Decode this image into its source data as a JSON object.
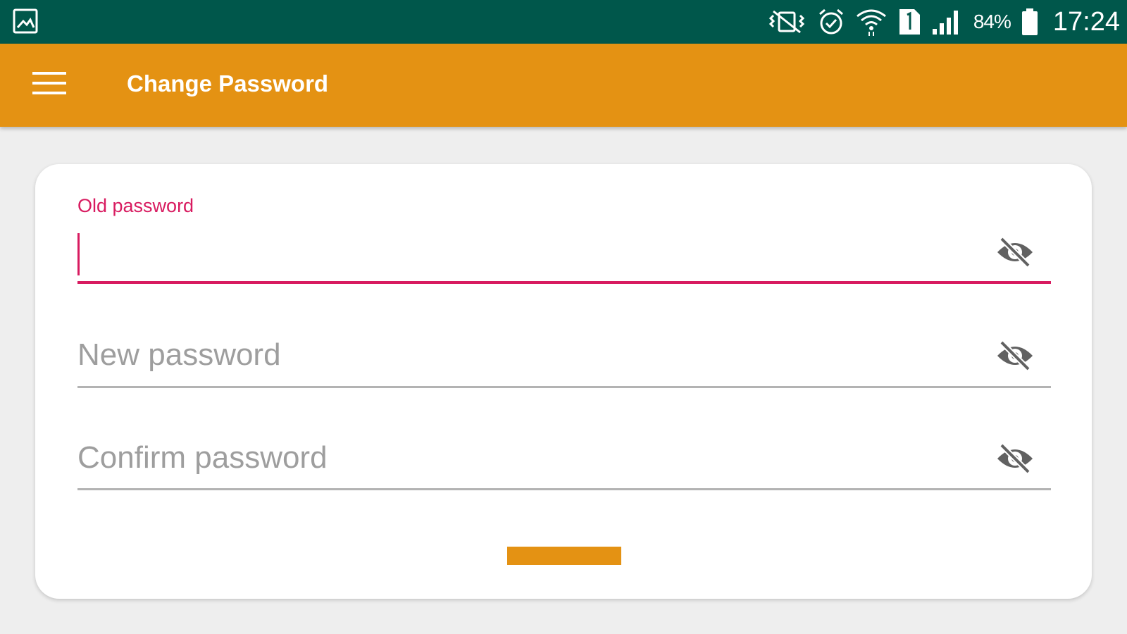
{
  "status_bar": {
    "icons": [
      "gallery-icon",
      "vibrate-icon",
      "alarm-icon",
      "wifi-icon",
      "sim-card-icon",
      "signal-icon",
      "battery-icon"
    ],
    "battery_percent": "84%",
    "time": "17:24"
  },
  "app_bar": {
    "menu_icon": "hamburger-menu-icon",
    "title": "Change Password"
  },
  "form": {
    "old_password": {
      "label": "Old password",
      "value": "",
      "focused": true,
      "toggle_icon": "visibility-off-icon"
    },
    "new_password": {
      "placeholder": "New password",
      "value": "",
      "toggle_icon": "visibility-off-icon"
    },
    "confirm_password": {
      "placeholder": "Confirm password",
      "value": "",
      "toggle_icon": "visibility-off-icon"
    },
    "submit_button": {
      "label": ""
    }
  },
  "colors": {
    "status_bar": "#00574b",
    "app_bar": "#e49213",
    "accent": "#d81b60",
    "background": "#eeeeee",
    "card": "#ffffff",
    "placeholder_text": "#9e9e9e",
    "icon": "#616161"
  }
}
